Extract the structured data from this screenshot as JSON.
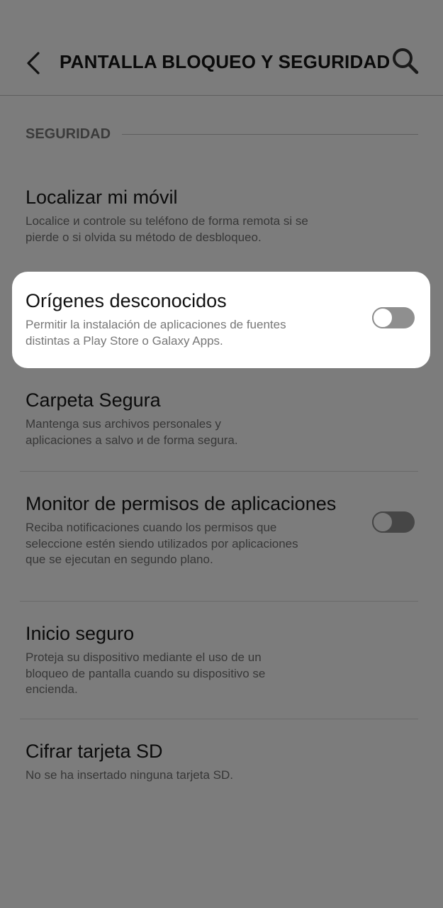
{
  "header": {
    "title": "PANTALLA BLOQUEO Y SEGURIDAD",
    "back_icon": "chevron-left-icon",
    "search_icon": "search-icon"
  },
  "section": {
    "title": "SEGURIDAD"
  },
  "items": [
    {
      "title": "Localizar mi móvil",
      "description": "Localice и controle su teléfono de forma remota si se pierde o si olvida su método de desbloqueo."
    },
    {
      "title": "Orígenes desconocidos",
      "description": "Permitir la instalación de aplicaciones de fuentes distintas a Play Store o Galaxy Apps.",
      "toggle_on": false,
      "highlighted": true
    },
    {
      "title": "Carpeta Segura",
      "description": "Mantenga sus archivos personales y aplicaciones a salvo и de forma segura."
    },
    {
      "title": "Monitor de permisos de aplicaciones",
      "description": "Reciba notificaciones cuando los permisos que seleccione estén siendo utilizados por aplicaciones que se ejecutan en segundo plano.",
      "toggle_on": false
    },
    {
      "title": "Inicio seguro",
      "description": "Proteja su dispositivo mediante el uso de un bloqueo de pantalla cuando su dispositivo se encienda."
    },
    {
      "title": "Cifrar tarjeta SD",
      "description": "No se ha insertado ninguna tarjeta SD."
    }
  ],
  "colors": {
    "overlay_background": "#7c7c7c",
    "highlight_card": "#ffffff",
    "toggle_off_track": "#8f8f8f"
  }
}
